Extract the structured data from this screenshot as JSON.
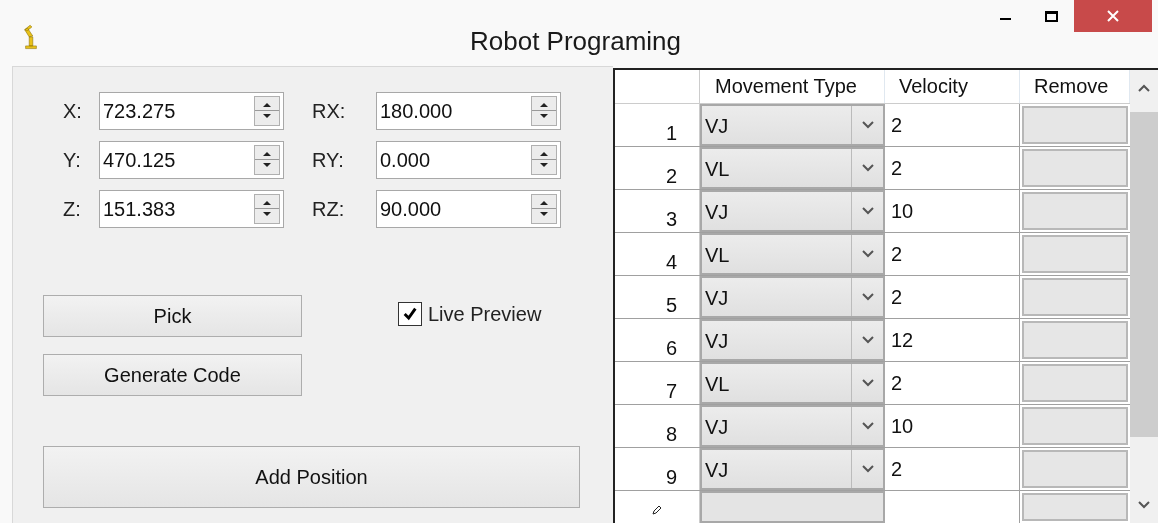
{
  "window": {
    "title": "Robot Programing"
  },
  "fields": [
    {
      "label": "X:",
      "value": "723.275"
    },
    {
      "label": "RX:",
      "value": "180.000"
    },
    {
      "label": "Y:",
      "value": "470.125"
    },
    {
      "label": "RY:",
      "value": "0.000"
    },
    {
      "label": "Z:",
      "value": "151.383"
    },
    {
      "label": "RZ:",
      "value": "90.000"
    }
  ],
  "buttons": [
    "Pick",
    "Generate Code"
  ],
  "live_preview": {
    "label": "Live Preview",
    "checked": true
  },
  "add_button": "Add Position",
  "grid": {
    "columns": [
      "Movement Type",
      "Velocity",
      "Remove"
    ],
    "rows": [
      {
        "number": "1",
        "movement_type": "VJ",
        "velocity": "2"
      },
      {
        "number": "2",
        "movement_type": "VL",
        "velocity": "2"
      },
      {
        "number": "3",
        "movement_type": "VJ",
        "velocity": "10"
      },
      {
        "number": "4",
        "movement_type": "VL",
        "velocity": "2"
      },
      {
        "number": "5",
        "movement_type": "VJ",
        "velocity": "2"
      },
      {
        "number": "6",
        "movement_type": "VJ",
        "velocity": "12"
      },
      {
        "number": "7",
        "movement_type": "VL",
        "velocity": "2"
      },
      {
        "number": "8",
        "movement_type": "VJ",
        "velocity": "10"
      },
      {
        "number": "9",
        "movement_type": "VJ",
        "velocity": "2"
      }
    ]
  }
}
